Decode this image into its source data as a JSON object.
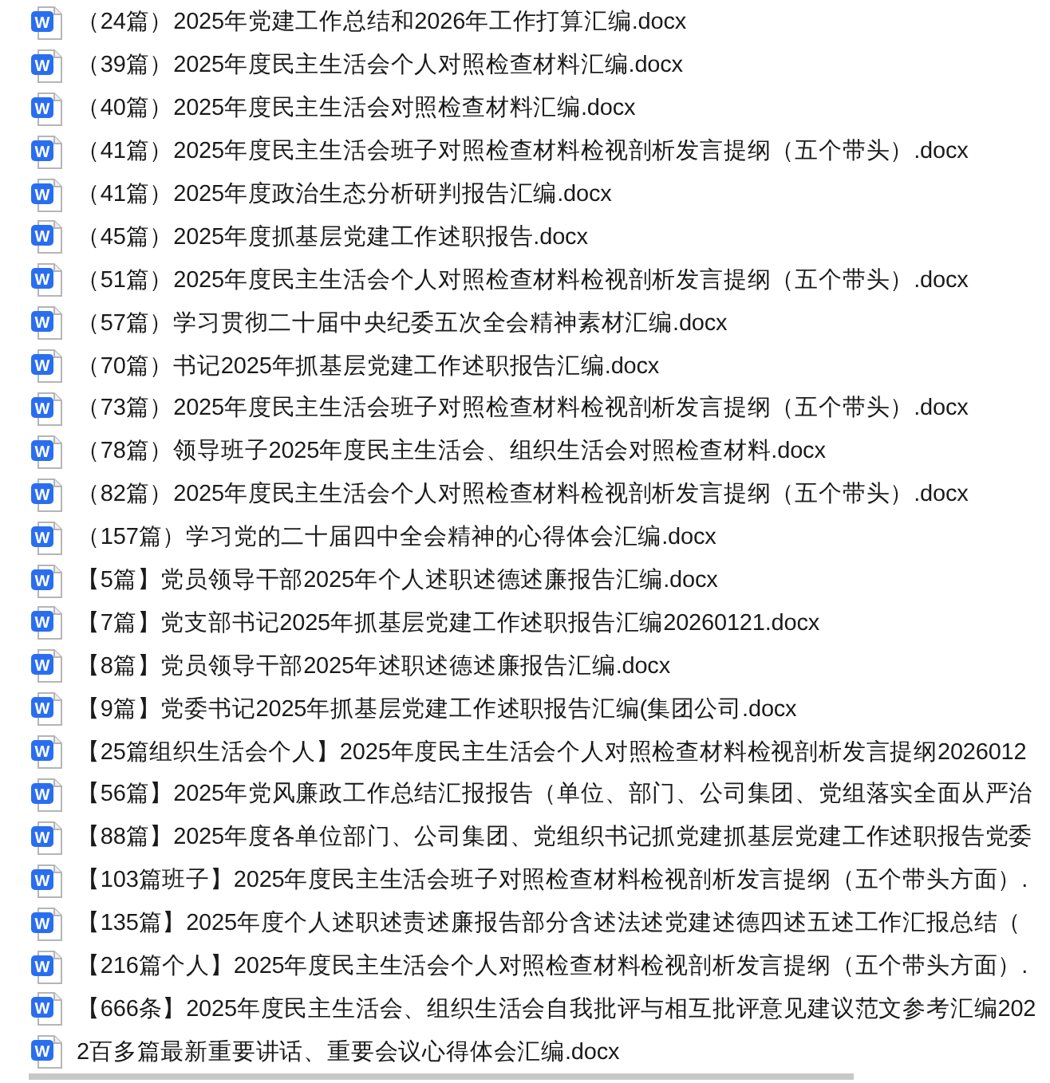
{
  "files": [
    {
      "name": "（24篇）2025年党建工作总结和2026年工作打算汇编.docx",
      "icon_letter": "W"
    },
    {
      "name": "（39篇）2025年度民主生活会个人对照检查材料汇编.docx",
      "icon_letter": "W"
    },
    {
      "name": "（40篇）2025年度民主生活会对照检查材料汇编.docx",
      "icon_letter": "W"
    },
    {
      "name": "（41篇）2025年度民主生活会班子对照检查材料检视剖析发言提纲（五个带头）.docx",
      "icon_letter": "W"
    },
    {
      "name": "（41篇）2025年度政治生态分析研判报告汇编.docx",
      "icon_letter": "W"
    },
    {
      "name": "（45篇）2025年度抓基层党建工作述职报告.docx",
      "icon_letter": "W"
    },
    {
      "name": "（51篇）2025年度民主生活会个人对照检查材料检视剖析发言提纲（五个带头）.docx",
      "icon_letter": "W"
    },
    {
      "name": "（57篇）学习贯彻二十届中央纪委五次全会精神素材汇编.docx",
      "icon_letter": "W"
    },
    {
      "name": "（70篇）书记2025年抓基层党建工作述职报告汇编.docx",
      "icon_letter": "W"
    },
    {
      "name": "（73篇）2025年度民主生活会班子对照检查材料检视剖析发言提纲（五个带头）.docx",
      "icon_letter": "W"
    },
    {
      "name": "（78篇）领导班子2025年度民主生活会、组织生活会对照检查材料.docx",
      "icon_letter": "W"
    },
    {
      "name": "（82篇）2025年度民主生活会个人对照检查材料检视剖析发言提纲（五个带头）.docx",
      "icon_letter": "W"
    },
    {
      "name": "（157篇）学习党的二十届四中全会精神的心得体会汇编.docx",
      "icon_letter": "W"
    },
    {
      "name": "【5篇】党员领导干部2025年个人述职述德述廉报告汇编.docx",
      "icon_letter": "W"
    },
    {
      "name": "【7篇】党支部书记2025年抓基层党建工作述职报告汇编20260121.docx",
      "icon_letter": "W"
    },
    {
      "name": "【8篇】党员领导干部2025年述职述德述廉报告汇编.docx",
      "icon_letter": "W"
    },
    {
      "name": "【9篇】党委书记2025年抓基层党建工作述职报告汇编(集团公司.docx",
      "icon_letter": "W"
    },
    {
      "name": "【25篇组织生活会个人】2025年度民主生活会个人对照检查材料检视剖析发言提纲2026012",
      "icon_letter": "W"
    },
    {
      "name": "【56篇】2025年党风廉政工作总结汇报报告（单位、部门、公司集团、党组落实全面从严治",
      "icon_letter": "W"
    },
    {
      "name": "【88篇】2025年度各单位部门、公司集团、党组织书记抓党建抓基层党建工作述职报告党委",
      "icon_letter": "W"
    },
    {
      "name": "【103篇班子】2025年度民主生活会班子对照检查材料检视剖析发言提纲（五个带头方面）.",
      "icon_letter": "W"
    },
    {
      "name": "【135篇】2025年度个人述职述责述廉报告部分含述法述党建述德四述五述工作汇报总结（",
      "icon_letter": "W"
    },
    {
      "name": "【216篇个人】2025年度民主生活会个人对照检查材料检视剖析发言提纲（五个带头方面）.",
      "icon_letter": "W"
    },
    {
      "name": "【666条】2025年度民主生活会、组织生活会自我批评与相互批评意见建议范文参考汇编202",
      "icon_letter": "W"
    },
    {
      "name": "2百多篇最新重要讲话、重要会议心得体会汇编.docx",
      "icon_letter": "W"
    }
  ]
}
